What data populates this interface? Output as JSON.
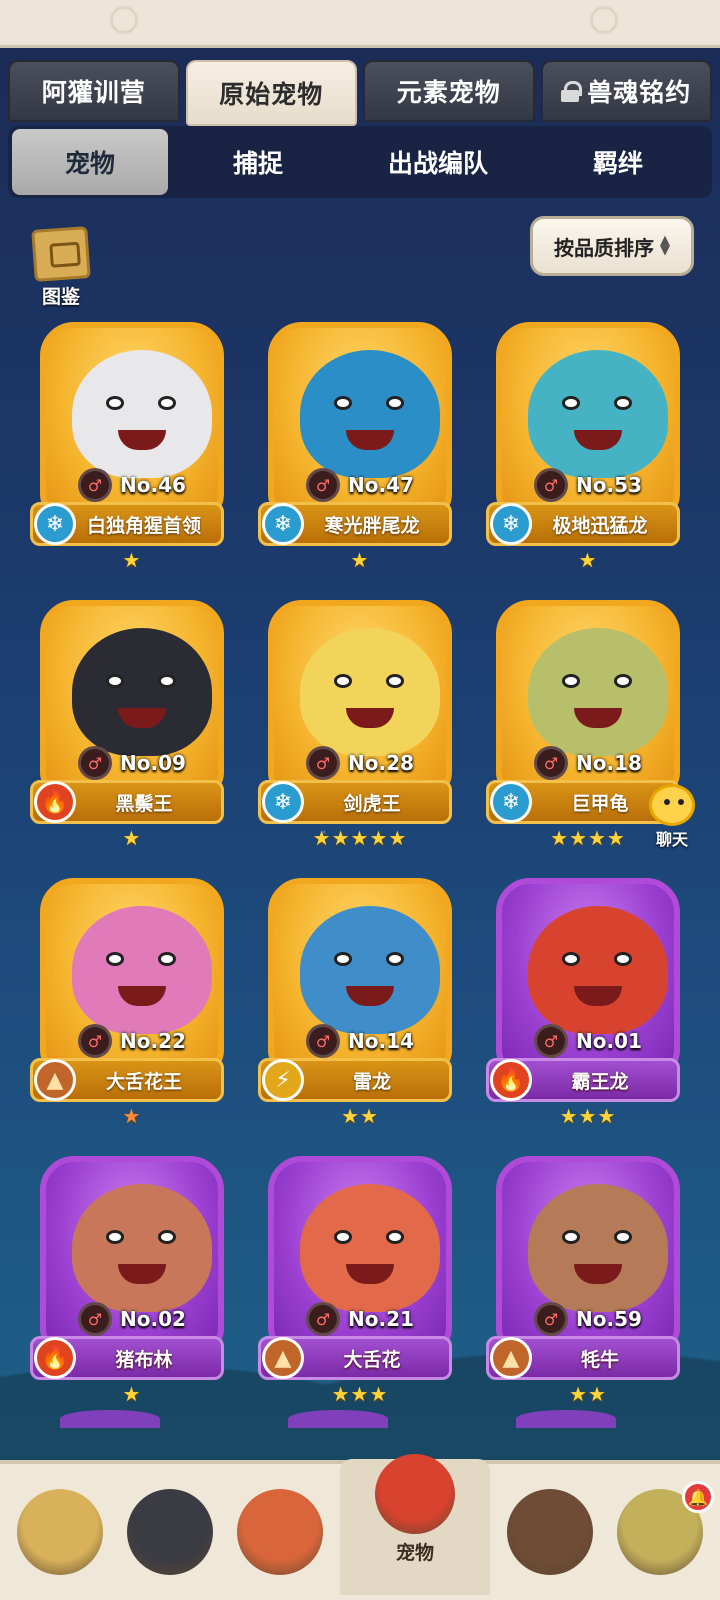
{
  "main_tabs": [
    {
      "label": "阿獾训营",
      "active": false,
      "locked": false
    },
    {
      "label": "原始宠物",
      "active": true,
      "locked": false
    },
    {
      "label": "元素宠物",
      "active": false,
      "locked": false
    },
    {
      "label": "兽魂铭约",
      "active": false,
      "locked": true
    }
  ],
  "sub_tabs": [
    {
      "label": "宠物",
      "active": true
    },
    {
      "label": "捕捉",
      "active": false
    },
    {
      "label": "出战编队",
      "active": false
    },
    {
      "label": "羁绊",
      "active": false
    }
  ],
  "pokedex": {
    "label": "图鉴",
    "icon": "book-icon"
  },
  "sort": {
    "label": "按品质排序",
    "icon": "sort-arrows-icon"
  },
  "pets": [
    {
      "no": "No.46",
      "name": "白独角猩首领",
      "element": "ice",
      "stars": "★",
      "rarity": "gold",
      "color": "#e8e8ea"
    },
    {
      "no": "No.47",
      "name": "寒光胖尾龙",
      "element": "ice",
      "stars": "★",
      "rarity": "gold",
      "color": "#2c8ec6"
    },
    {
      "no": "No.53",
      "name": "极地迅猛龙",
      "element": "ice",
      "stars": "★",
      "rarity": "gold",
      "color": "#46b3c4"
    },
    {
      "no": "No.09",
      "name": "黑鬃王",
      "element": "fire",
      "stars": "★",
      "rarity": "gold",
      "color": "#2b2b33"
    },
    {
      "no": "No.28",
      "name": "剑虎王",
      "element": "ice",
      "stars": "★★★★★",
      "rarity": "gold",
      "color": "#f3d45a"
    },
    {
      "no": "No.18",
      "name": "巨甲龟",
      "element": "ice",
      "stars": "★★★★",
      "rarity": "gold",
      "color": "#b8bf6a"
    },
    {
      "no": "No.22",
      "name": "大舌花王",
      "element": "earth",
      "stars": "★",
      "rarity": "gold",
      "color": "#e07ab8"
    },
    {
      "no": "No.14",
      "name": "雷龙",
      "element": "thunder",
      "stars": "★★",
      "rarity": "gold",
      "color": "#3f8ec9"
    },
    {
      "no": "No.01",
      "name": "霸王龙",
      "element": "fire",
      "stars": "★★★",
      "rarity": "purple",
      "color": "#d8432f"
    },
    {
      "no": "No.02",
      "name": "猪布林",
      "element": "fire",
      "stars": "★",
      "rarity": "purple",
      "color": "#c9775a"
    },
    {
      "no": "No.21",
      "name": "大舌花",
      "element": "earth",
      "stars": "★★★",
      "rarity": "purple",
      "color": "#e26a4a"
    },
    {
      "no": "No.59",
      "name": "牦牛",
      "element": "earth",
      "stars": "★★",
      "rarity": "purple",
      "color": "#b57a58"
    }
  ],
  "chat": {
    "label": "聊天"
  },
  "bottom_nav": [
    {
      "label": "",
      "color": "#d8b15a",
      "active": false
    },
    {
      "label": "",
      "color": "#3b3b44",
      "active": false
    },
    {
      "label": "",
      "color": "#d9663a",
      "active": false
    },
    {
      "label": "宠物",
      "color": "#d8432f",
      "active": true
    },
    {
      "label": "",
      "color": "#6e4c35",
      "active": false
    },
    {
      "label": "",
      "color": "#c3b05b",
      "active": false,
      "notification": true
    }
  ],
  "colors": {
    "accent_gold": "#f2a81e",
    "accent_purple": "#b04ad9",
    "star": "#ffd43a",
    "background": "#1c3a6c"
  }
}
